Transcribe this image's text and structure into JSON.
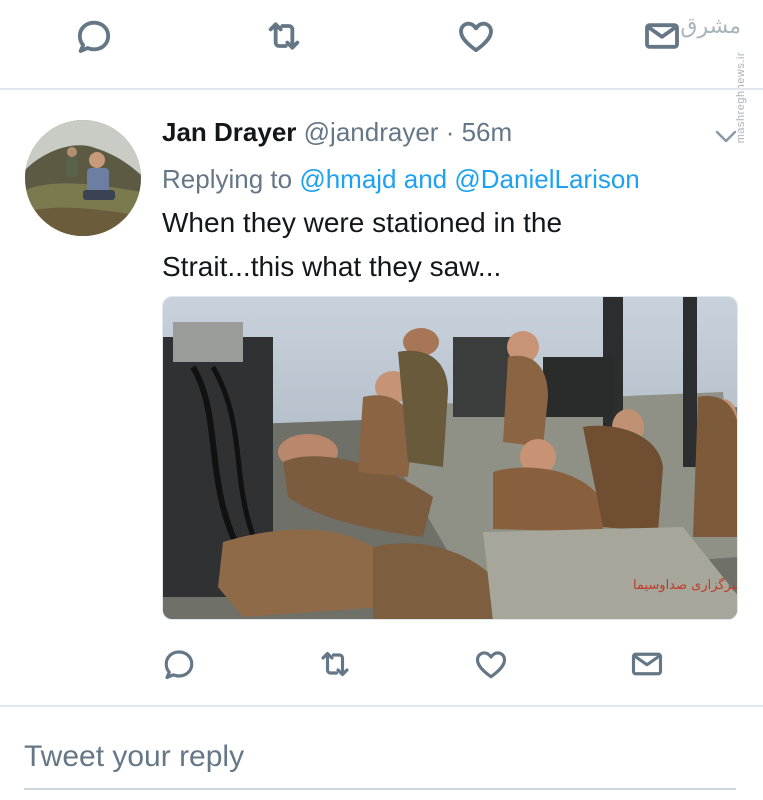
{
  "top_actions": {
    "icons": [
      "reply-icon",
      "retweet-icon",
      "like-icon",
      "direct-message-icon"
    ]
  },
  "watermark": {
    "logo": "ﻣﺸﺮﻕ",
    "site": "mashreghnews.ir"
  },
  "tweet": {
    "author_name": "Jan Drayer",
    "author_handle": "@jandrayer",
    "separator": "·",
    "time": "56m",
    "replying_prefix": "Replying to",
    "reply_mention_1": "@hmajd",
    "reply_conjunction": "and",
    "reply_mention_2": "@DanielLarison",
    "text_line_1": "When they were stationed in the",
    "text_line_2": "Strait...this what they saw...",
    "media_caption": "خبرگزاری صداوسیما"
  },
  "bottom_actions": {
    "icons": [
      "reply-icon",
      "retweet-icon",
      "like-icon",
      "direct-message-icon"
    ]
  },
  "reply_box": {
    "placeholder": "Tweet your reply"
  },
  "colors": {
    "accent": "#1da1f2",
    "secondary_text": "#657786",
    "divider": "#e1e8ed"
  }
}
